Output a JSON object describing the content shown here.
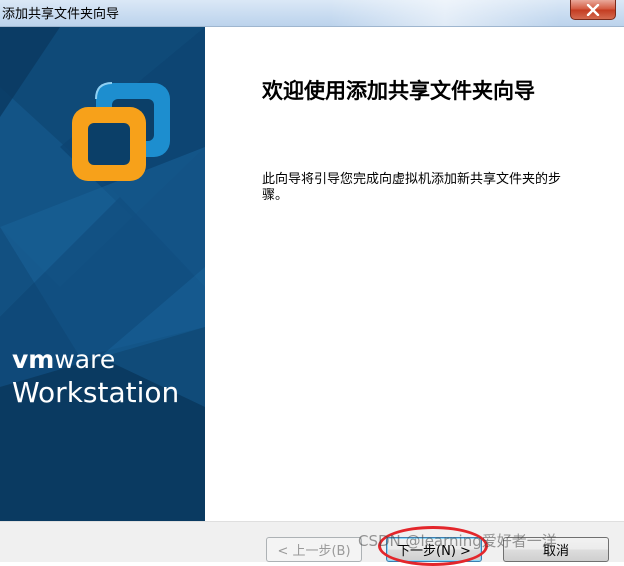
{
  "window": {
    "title": "添加共享文件夹向导",
    "close_symbol": "×"
  },
  "banner": {
    "brand_vm": "vm",
    "brand_ware": "ware",
    "product": "Workstation",
    "logo_icon": "vmware-logo-icon"
  },
  "content": {
    "heading": "欢迎使用添加共享文件夹向导",
    "description": "此向导将引导您完成向虚拟机添加新共享文件夹的步骤。"
  },
  "buttons": {
    "back": "< 上一步(B)",
    "next": "下一步(N) >",
    "cancel": "取消"
  },
  "watermark": "CSDN @learning爱好者一洋",
  "colors": {
    "banner_bg": "#0b3f68",
    "logo_orange": "#f7a11a",
    "logo_blue": "#1d8ecf",
    "highlight": "#e3262b"
  }
}
